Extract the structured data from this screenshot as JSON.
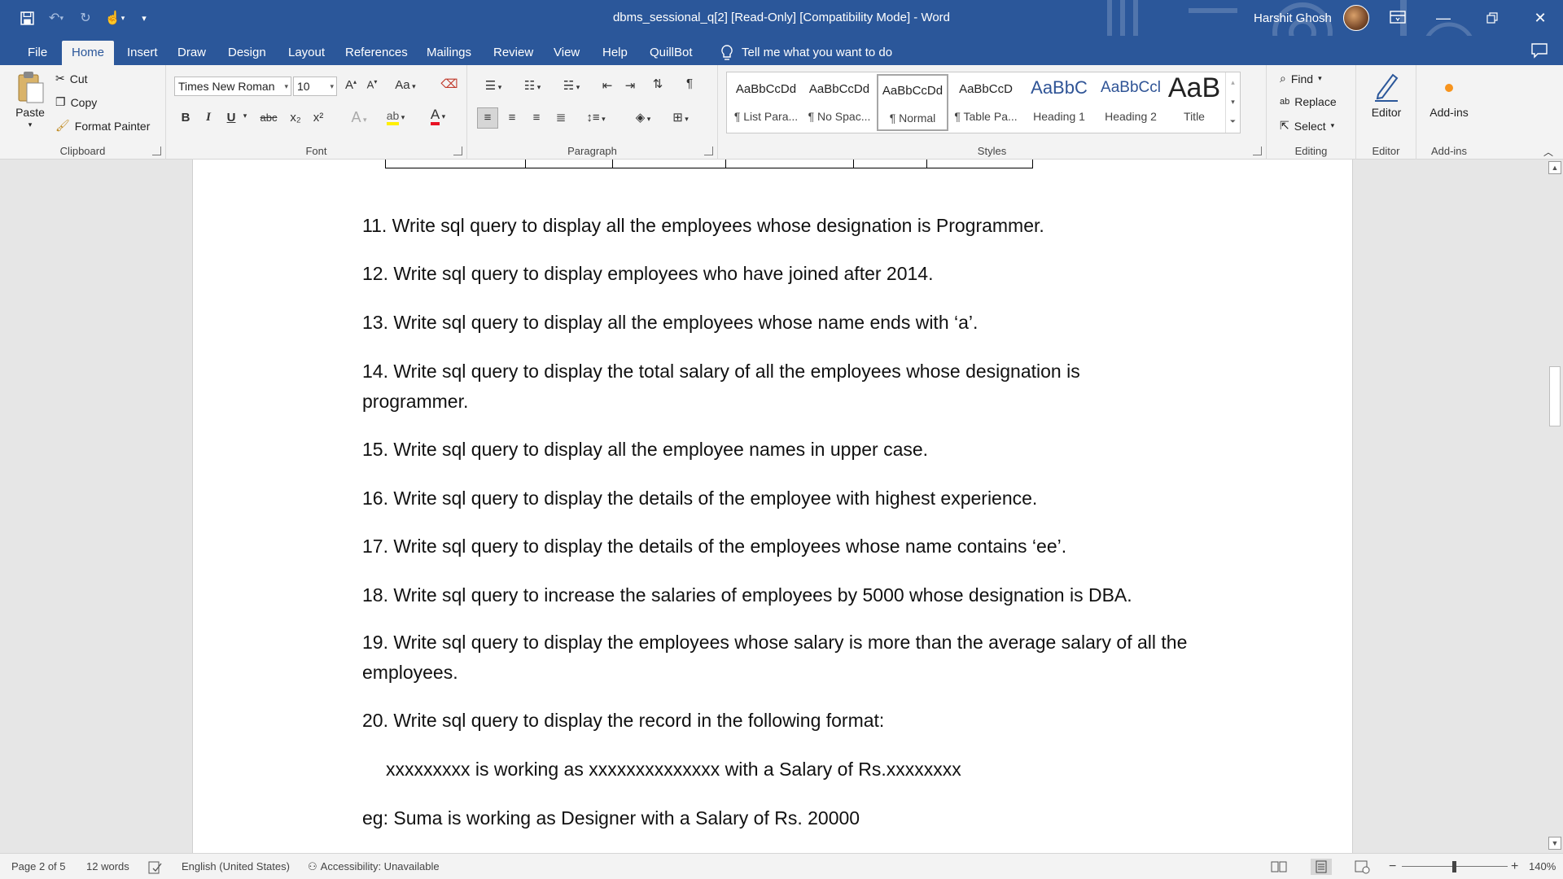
{
  "window": {
    "title": "dbms_sessional_q[2] [Read-Only] [Compatibility Mode]  -  Word",
    "user_name": "Harshit Ghosh",
    "minimize_icon": "minimize-icon",
    "restore_icon": "restore-icon",
    "close_icon": "close-icon"
  },
  "quick_access": {
    "icons": [
      "save-icon",
      "undo-icon",
      "redo-icon",
      "touch-mode-icon",
      "customize-qat-icon"
    ]
  },
  "tabs": [
    {
      "label": "File"
    },
    {
      "label": "Home"
    },
    {
      "label": "Insert"
    },
    {
      "label": "Draw"
    },
    {
      "label": "Design"
    },
    {
      "label": "Layout"
    },
    {
      "label": "References"
    },
    {
      "label": "Mailings"
    },
    {
      "label": "Review"
    },
    {
      "label": "View"
    },
    {
      "label": "Help"
    },
    {
      "label": "QuillBot"
    }
  ],
  "active_tab": "Home",
  "tell_me": "Tell me what you want to do",
  "ribbon": {
    "clipboard": {
      "label": "Clipboard",
      "paste": "Paste",
      "cut": "Cut",
      "copy": "Copy",
      "format_painter": "Format Painter"
    },
    "font": {
      "label": "Font",
      "font_name": "Times New Roman",
      "font_size": "10",
      "change_case": "Aa",
      "bold": "B",
      "italic": "I",
      "underline": "U",
      "strikethrough": "abc",
      "subscript": "x₂",
      "superscript": "x²"
    },
    "paragraph": {
      "label": "Paragraph",
      "pilcrow": "¶"
    },
    "styles": {
      "label": "Styles",
      "items": [
        {
          "sample": "AaBbCcDd",
          "name": "¶ List Para..."
        },
        {
          "sample": "AaBbCcDd",
          "name": "¶ No Spac..."
        },
        {
          "sample": "AaBbCcDd",
          "name": "¶ Normal"
        },
        {
          "sample": "AaBbCcD",
          "name": "¶ Table Pa..."
        },
        {
          "sample": "AaBbC",
          "name": "Heading 1"
        },
        {
          "sample": "AaBbCcl",
          "name": "Heading 2"
        },
        {
          "sample": "AaB",
          "name": "Title"
        }
      ],
      "selected_index": 2
    },
    "editing": {
      "label": "Editing",
      "find": "Find",
      "replace": "Replace",
      "select": "Select"
    },
    "editor": {
      "label": "Editor",
      "button": "Editor"
    },
    "addins": {
      "label": "Add-ins",
      "button": "Add-ins"
    }
  },
  "document": {
    "paragraphs": [
      "11. Write sql query to display all the employees whose designation is Programmer.",
      "12. Write sql query to display employees who have joined after 2014.",
      "13. Write sql query to display all the employees whose name ends with ‘a’.",
      "14.   Write sql query to display the total salary of all the employees whose designation is programmer.",
      "15. Write sql query to display all the employee names in upper case.",
      "16. Write sql query to display the details of the employee with highest experience.",
      "17. Write sql query to display the details of the employees whose name contains ‘ee’.",
      "18. Write sql query to increase the salaries of employees by 5000 whose designation is DBA.",
      "19. Write sql query to display the employees whose salary is more than the average salary of all the employees.",
      "20. Write sql query to display the record in the following format:",
      "xxxxxxxxx is working as xxxxxxxxxxxxxx with a Salary of Rs.xxxxxxxx",
      "eg: Suma is working as Designer with a Salary of Rs. 20000"
    ]
  },
  "status": {
    "page": "Page 2 of 5",
    "words": "12 words",
    "language": "English (United States)",
    "accessibility": "Accessibility: Unavailable",
    "zoom_minus": "−",
    "zoom_plus": "+",
    "zoom": "140%"
  }
}
